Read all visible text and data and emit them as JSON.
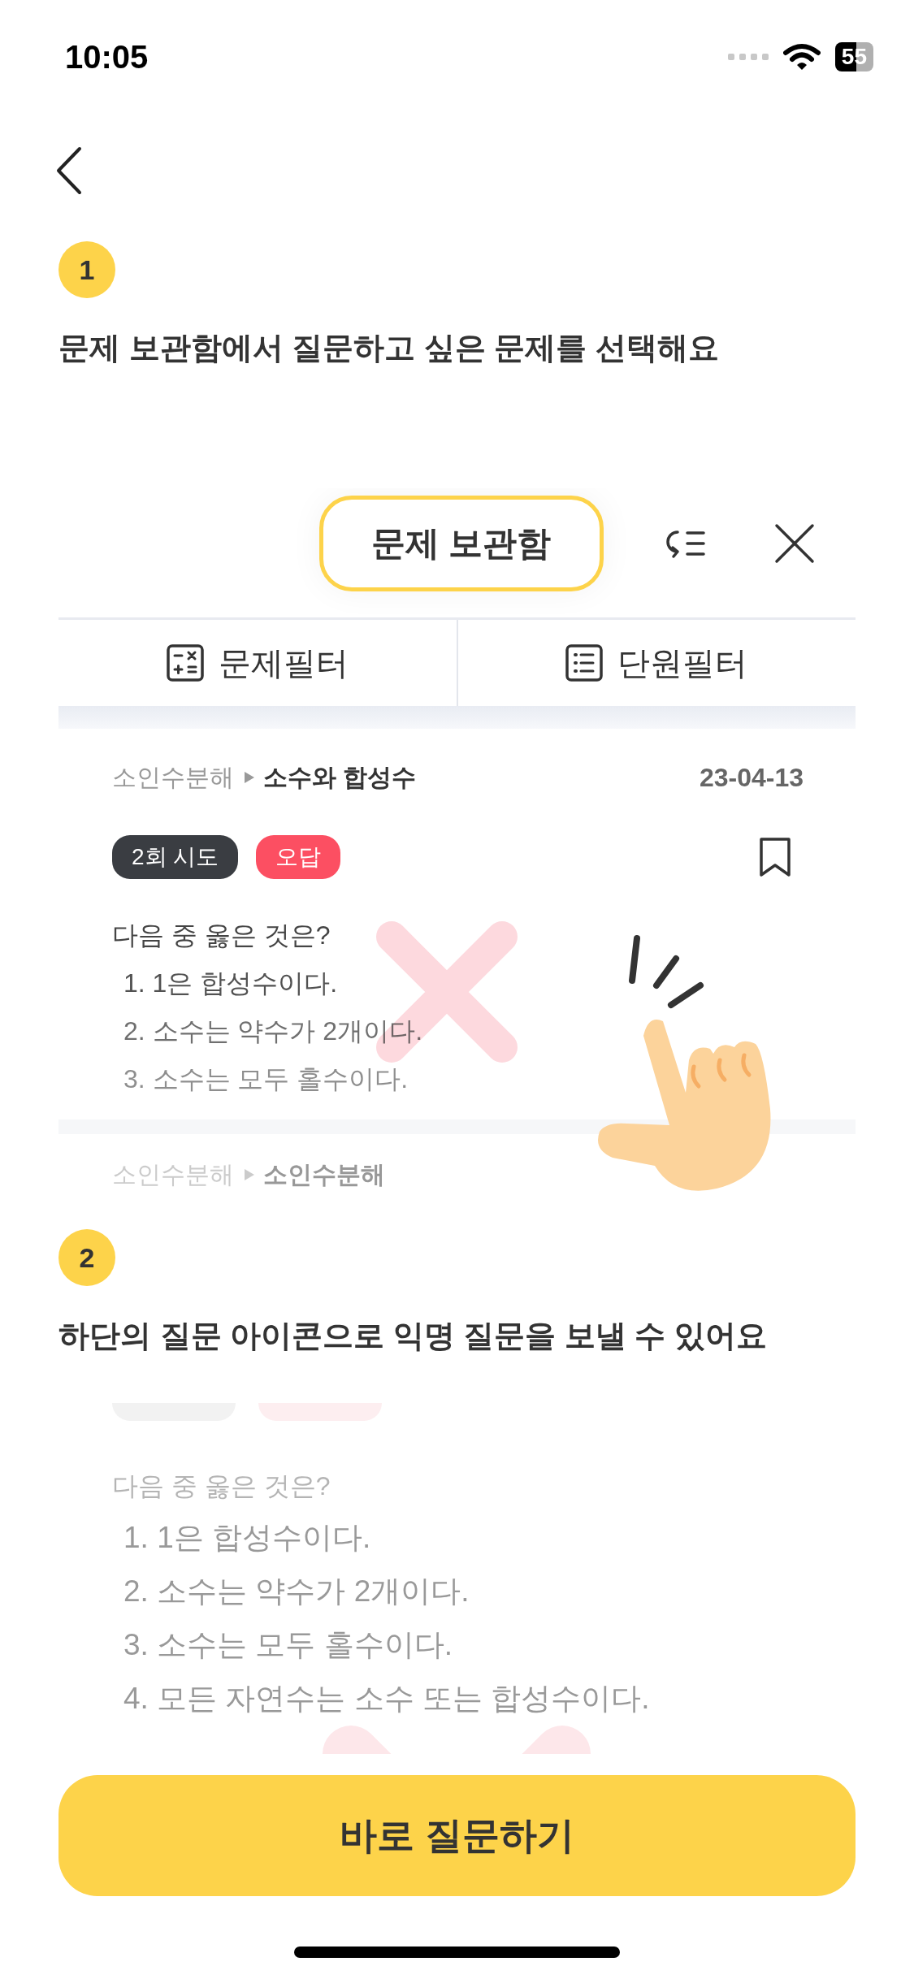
{
  "status_bar": {
    "time": "10:05",
    "battery": "55"
  },
  "step1": {
    "number": "1",
    "text": "문제 보관함에서 질문하고 싶은 문제를 선택해요"
  },
  "preview1": {
    "title": "문제 보관함",
    "filters": [
      {
        "label": "문제필터",
        "kind": "calculator"
      },
      {
        "label": "단원필터",
        "kind": "list"
      }
    ],
    "card": {
      "parent": "소인수분해",
      "child": "소수와 합성수",
      "date": "23-04-13",
      "tags": [
        {
          "text": "2회 시도",
          "kind": "attempts"
        },
        {
          "text": "오답",
          "kind": "wrong"
        }
      ],
      "question": "다음 중 옳은 것은?",
      "options": [
        "1. 1은 합성수이다.",
        "2. 소수는 약수가 2개이다.",
        "3. 소수는 모두 홀수이다."
      ]
    },
    "next_card": {
      "parent": "소인수분해",
      "child": "소인수분해"
    }
  },
  "step2": {
    "number": "2",
    "text": "하단의 질문 아이콘으로 익명 질문을 보낼 수 있어요"
  },
  "preview2": {
    "question": "다음 중 옳은 것은?",
    "options": [
      "1. 1은 합성수이다.",
      "2. 소수는 약수가 2개이다.",
      "3. 소수는 모두 홀수이다.",
      "4. 모든 자연수는 소수 또는 합성수이다."
    ]
  },
  "button": "바로 질문하기"
}
